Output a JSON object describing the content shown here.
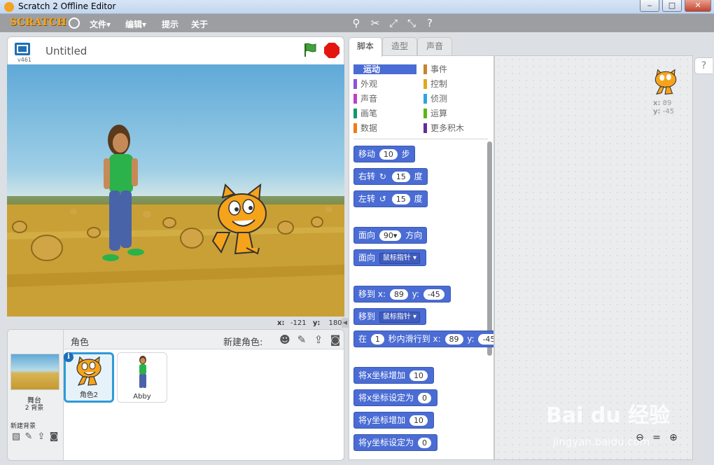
{
  "window": {
    "title": "Scratch 2 Offline Editor",
    "minimize": "‒",
    "maximize": "□",
    "close": "✕"
  },
  "menubar": {
    "logo": "SCRATCH",
    "menus": [
      "文件▾",
      "编辑▾",
      "提示",
      "关于"
    ]
  },
  "stage": {
    "version": "v461",
    "project_title": "Untitled",
    "mouse_x_label": "x:",
    "mouse_x": "-121",
    "mouse_y_label": "y:",
    "mouse_y": "180"
  },
  "sprites_pane": {
    "stage_label": "舞台",
    "backdrop_count": "2 背景",
    "new_backdrop_label": "新建背景",
    "sprites_label": "角色",
    "new_sprite_label": "新建角色:",
    "sprites": [
      {
        "name": "角色2",
        "selected": true
      },
      {
        "name": "Abby",
        "selected": false
      }
    ]
  },
  "tabs": [
    "脚本",
    "造型",
    "声音"
  ],
  "categories": [
    {
      "label": "运动",
      "color": "#4a6cd4",
      "active": true
    },
    {
      "label": "事件",
      "color": "#c88330",
      "active": false
    },
    {
      "label": "外观",
      "color": "#8a55d7",
      "active": false
    },
    {
      "label": "控制",
      "color": "#e1a91a",
      "active": false
    },
    {
      "label": "声音",
      "color": "#bb42c3",
      "active": false
    },
    {
      "label": "侦测",
      "color": "#2ca5e2",
      "active": false
    },
    {
      "label": "画笔",
      "color": "#0e9a6c",
      "active": false
    },
    {
      "label": "运算",
      "color": "#5cb712",
      "active": false
    },
    {
      "label": "数据",
      "color": "#ee7d16",
      "active": false
    },
    {
      "label": "更多积木",
      "color": "#632d99",
      "active": false
    }
  ],
  "blocks": {
    "move": {
      "label": "移动",
      "value": "10",
      "suffix": "步"
    },
    "turn_right": {
      "label": "右转",
      "value": "15",
      "suffix": "度"
    },
    "turn_left": {
      "label": "左转",
      "value": "15",
      "suffix": "度"
    },
    "point_dir": {
      "label": "面向",
      "value": "90▾",
      "suffix": "方向"
    },
    "point_towards": {
      "label": "面向",
      "dropdown": "鼠标指针 ▾"
    },
    "goto_xy": {
      "label": "移到",
      "x_label": "x:",
      "x": "89",
      "y_label": "y:",
      "y": "-45"
    },
    "goto": {
      "label": "移到",
      "dropdown": "鼠标指针 ▾"
    },
    "glide": {
      "label": "在",
      "secs": "1",
      "mid": "秒内滑行到",
      "x_label": "x:",
      "x": "89",
      "y_label": "y:",
      "y": "-45"
    },
    "change_x": {
      "label": "将x坐标增加",
      "value": "10"
    },
    "set_x": {
      "label": "将x坐标设定为",
      "value": "0"
    },
    "change_y": {
      "label": "将y坐标增加",
      "value": "10"
    },
    "set_y": {
      "label": "将y坐标设定为",
      "value": "0"
    }
  },
  "script_area": {
    "x_label": "x:",
    "x": "89",
    "y_label": "y:",
    "y": "-45"
  },
  "help": "?",
  "watermark": {
    "main": "Bai du 经验",
    "sub": "jingyan.baidu.com"
  }
}
